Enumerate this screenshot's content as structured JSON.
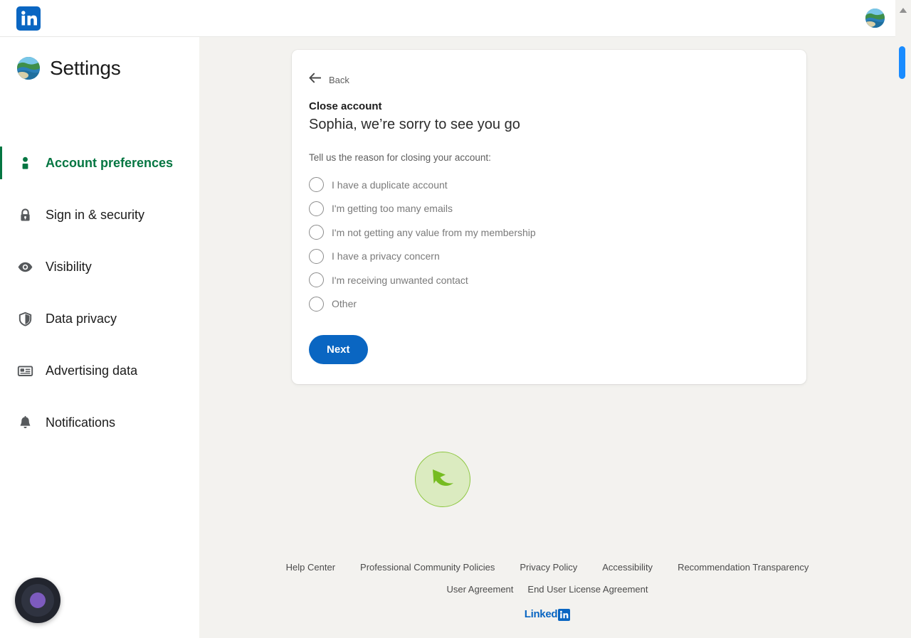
{
  "topnav": {
    "logo_icon": "linkedin-logo-icon",
    "avatar_icon": "user-avatar"
  },
  "sidebar": {
    "title": "Settings",
    "avatar_icon": "user-avatar",
    "items": [
      {
        "label": "Account preferences",
        "icon": "person-icon",
        "active": true
      },
      {
        "label": "Sign in & security",
        "icon": "lock-icon",
        "active": false
      },
      {
        "label": "Visibility",
        "icon": "eye-icon",
        "active": false
      },
      {
        "label": "Data privacy",
        "icon": "shield-icon",
        "active": false
      },
      {
        "label": "Advertising data",
        "icon": "id-card-icon",
        "active": false
      },
      {
        "label": "Notifications",
        "icon": "bell-icon",
        "active": false
      }
    ]
  },
  "card": {
    "back_label": "Back",
    "back_icon": "arrow-left-icon",
    "section_title": "Close account",
    "heading": "Sophia, we’re sorry to see you go",
    "prompt": "Tell us the reason for closing your account:",
    "reasons": [
      {
        "label": "I have a duplicate account",
        "selected": false
      },
      {
        "label": "I'm getting too many emails",
        "selected": false
      },
      {
        "label": "I'm not getting any value from my membership",
        "selected": false
      },
      {
        "label": "I have a privacy concern",
        "selected": false
      },
      {
        "label": "I'm receiving unwanted contact",
        "selected": false
      },
      {
        "label": "Other",
        "selected": false
      }
    ],
    "next_label": "Next"
  },
  "cursor_marker": {
    "icon": "cursor-arrow-icon"
  },
  "footer": {
    "row1": [
      "Help Center",
      "Professional Community Policies",
      "Privacy Policy",
      "Accessibility",
      "Recommendation Transparency"
    ],
    "row2": [
      "User Agreement",
      "End User License Agreement"
    ],
    "logo_text": "Linked",
    "logo_mark": "in"
  },
  "scrollbar": {
    "up_arrow_icon": "chevron-up-icon"
  },
  "fab": {
    "icon": "record-button-icon"
  },
  "colors": {
    "brand_blue": "#0a66c2",
    "active_green": "#057642",
    "page_bg": "#f3f2ef",
    "card_bg": "#ffffff",
    "marker_green": "#8cc63e",
    "scroll_thumb": "#1a8cff"
  }
}
